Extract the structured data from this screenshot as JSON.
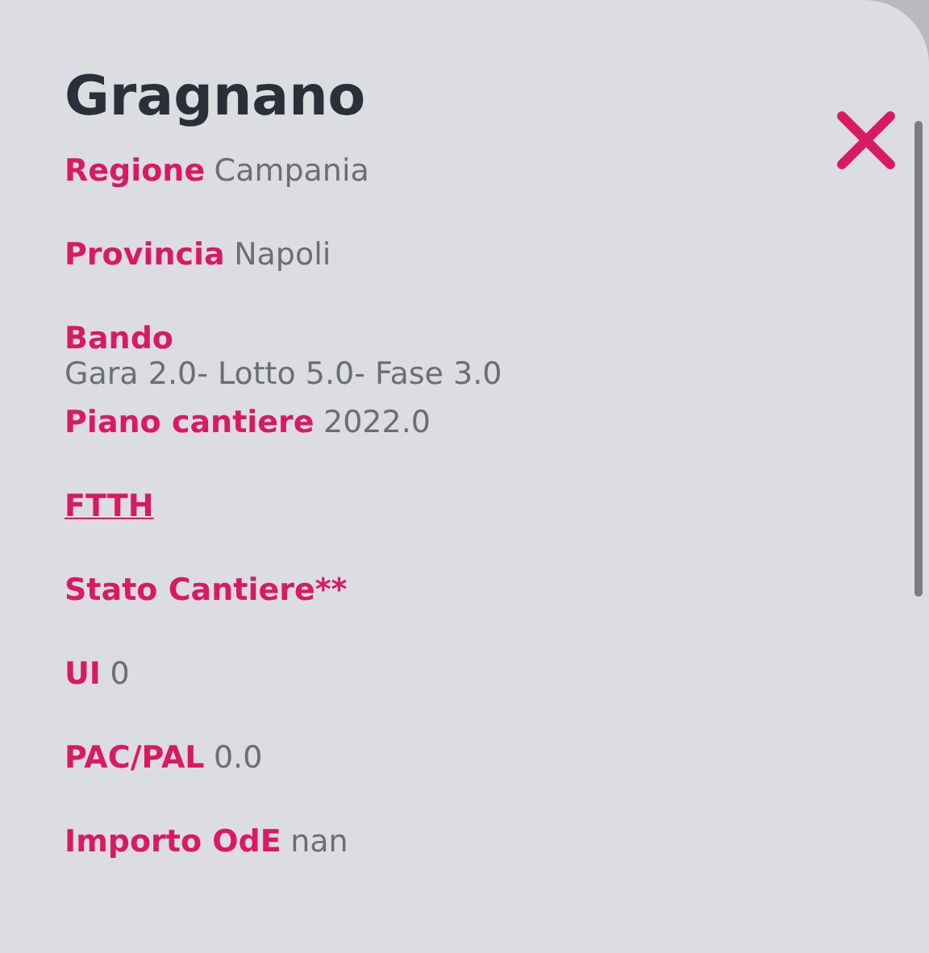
{
  "title": "Gragnano",
  "fields": [
    {
      "kind": "inline",
      "label": "Regione",
      "value": "Campania"
    },
    {
      "kind": "inline",
      "label": "Provincia",
      "value": "Napoli"
    },
    {
      "kind": "block",
      "label": "Bando",
      "value": "Gara 2.0- Lotto 5.0- Fase 3.0"
    },
    {
      "kind": "inline",
      "label": "Piano cantiere",
      "value": "2022.0"
    },
    {
      "kind": "link",
      "label": "FTTH"
    },
    {
      "kind": "inline",
      "label": "Stato Cantiere**"
    },
    {
      "kind": "inline",
      "label": "UI",
      "value": "0"
    },
    {
      "kind": "inline",
      "label": "PAC/PAL",
      "value": "0.0"
    },
    {
      "kind": "inline",
      "label": "Importo OdE",
      "value": "nan"
    }
  ]
}
